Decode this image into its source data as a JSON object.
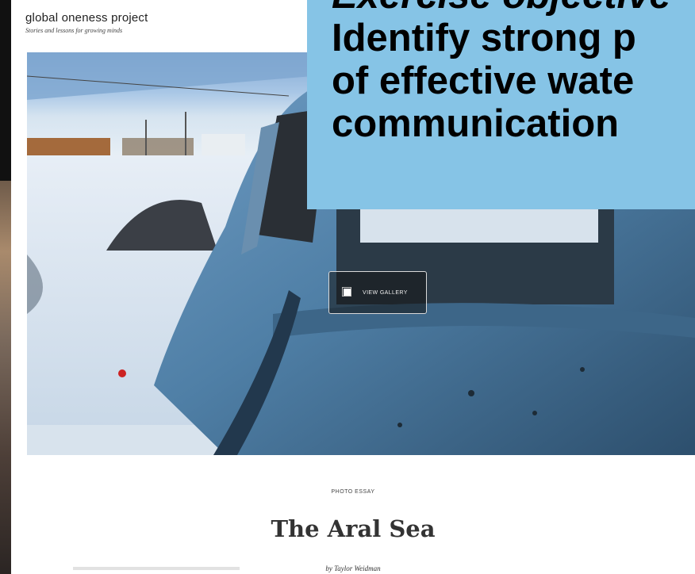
{
  "site": {
    "name": "global oneness project",
    "tagline": "Stories and lessons for growing minds"
  },
  "hero": {
    "button_label": "VIEW GALLERY",
    "button_icon": "gallery-icon"
  },
  "article": {
    "kicker": "PHOTO ESSAY",
    "title": "The Aral Sea",
    "byline": "by Taylor Weidman"
  },
  "overlay": {
    "heading": "Exercise objective",
    "lines": [
      "Identify strong p",
      "of effective wate",
      "communication"
    ]
  },
  "colors": {
    "overlay_bg": "#86c4e6",
    "truck_blue": "#4f7fa6",
    "page_bg": "#ffffff",
    "backdrop": "#111111"
  }
}
